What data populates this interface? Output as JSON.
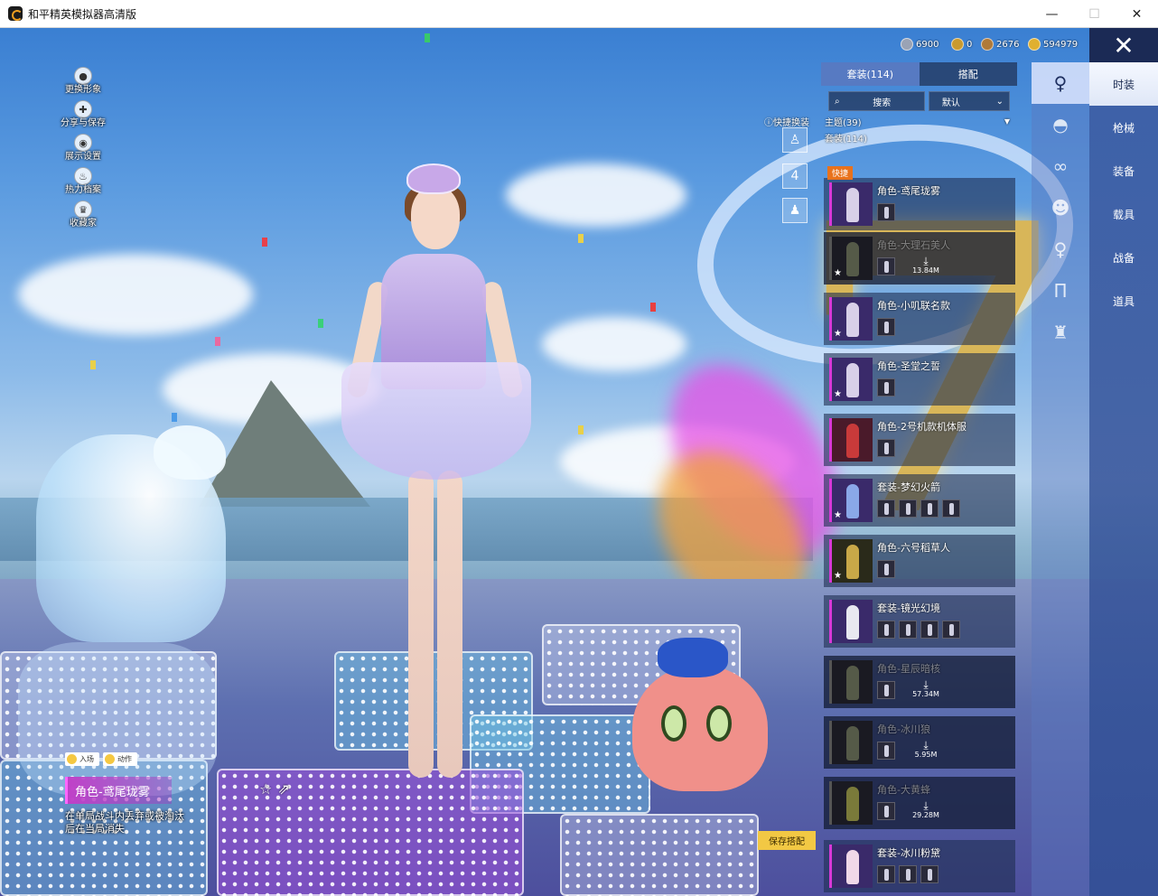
{
  "window": {
    "title": "和平精英模拟器高清版",
    "minimize": "—",
    "maximize": "☐",
    "close": "✕"
  },
  "left_menu": [
    {
      "label": "更换形象",
      "icon": "person-icon"
    },
    {
      "label": "分享与保存",
      "icon": "share-icon"
    },
    {
      "label": "展示设置",
      "icon": "eye-icon"
    },
    {
      "label": "热力档案",
      "icon": "flame-icon"
    },
    {
      "label": "收藏家",
      "icon": "collector-badge-icon"
    }
  ],
  "currency": [
    {
      "value": "6900",
      "color": "#9aa3b5"
    },
    {
      "value": "0",
      "color": "#c99a2e"
    },
    {
      "value": "2676",
      "color": "#b07a3a"
    },
    {
      "value": "594979",
      "color": "#e0b030"
    }
  ],
  "close_label": "✕",
  "categories": [
    {
      "label": "时装",
      "active": true
    },
    {
      "label": "枪械",
      "active": false
    },
    {
      "label": "装备",
      "active": false
    },
    {
      "label": "载具",
      "active": false
    },
    {
      "label": "战备",
      "active": false
    },
    {
      "label": "道具",
      "active": false
    }
  ],
  "slot_icons": [
    {
      "icon": "outfit-icon",
      "active": true
    },
    {
      "icon": "hat-icon",
      "active": false
    },
    {
      "icon": "glasses-icon",
      "active": false
    },
    {
      "icon": "mask-icon",
      "active": false
    },
    {
      "icon": "figure-icon",
      "active": false
    },
    {
      "icon": "pants-icon",
      "active": false
    },
    {
      "icon": "shoes-icon",
      "active": false
    }
  ],
  "panel": {
    "tab_sets": "套装(114)",
    "tab_match": "搭配",
    "search_label": "搜索",
    "sort_label": "默认",
    "filter_theme": "主题(39)",
    "filter_sets": "套装(114)",
    "badge_fast": "快捷"
  },
  "quick": {
    "label": "快捷换装",
    "slot2_number": "4"
  },
  "items": [
    {
      "name": "角色-鸢尾珑雾",
      "dim": false,
      "star": false,
      "minis": 1,
      "size": ""
    },
    {
      "name": "角色-大理石美人",
      "dim": true,
      "star": true,
      "minis": 1,
      "size": "13.84M"
    },
    {
      "name": "角色-小叽联名款",
      "dim": false,
      "star": true,
      "minis": 1,
      "size": ""
    },
    {
      "name": "角色-圣堂之誓",
      "dim": false,
      "star": true,
      "minis": 1,
      "size": ""
    },
    {
      "name": "角色-2号机款机体服",
      "dim": false,
      "star": false,
      "minis": 1,
      "size": ""
    },
    {
      "name": "套装-梦幻火箭",
      "dim": false,
      "star": true,
      "minis": 4,
      "size": ""
    },
    {
      "name": "角色-六号稻草人",
      "dim": false,
      "star": true,
      "minis": 1,
      "size": ""
    },
    {
      "name": "套装-镜光幻境",
      "dim": false,
      "star": false,
      "minis": 4,
      "size": ""
    },
    {
      "name": "角色-星辰暗核",
      "dim": true,
      "star": false,
      "minis": 1,
      "size": "57.34M"
    },
    {
      "name": "角色-冰川狼",
      "dim": true,
      "star": false,
      "minis": 1,
      "size": "5.95M"
    },
    {
      "name": "角色-大黄蜂",
      "dim": true,
      "star": false,
      "minis": 1,
      "size": "29.28M"
    },
    {
      "name": "套装-冰川粉黛",
      "dim": false,
      "star": false,
      "minis": 3,
      "size": ""
    }
  ],
  "save_button": "保存搭配",
  "action_tabs": [
    "入场",
    "动作"
  ],
  "current_name": "角色-鸢尾珑雾",
  "hint": "在单局战斗内丢弃或被淘汰后在当局消失",
  "share_icons": [
    "☆",
    "⇗"
  ]
}
